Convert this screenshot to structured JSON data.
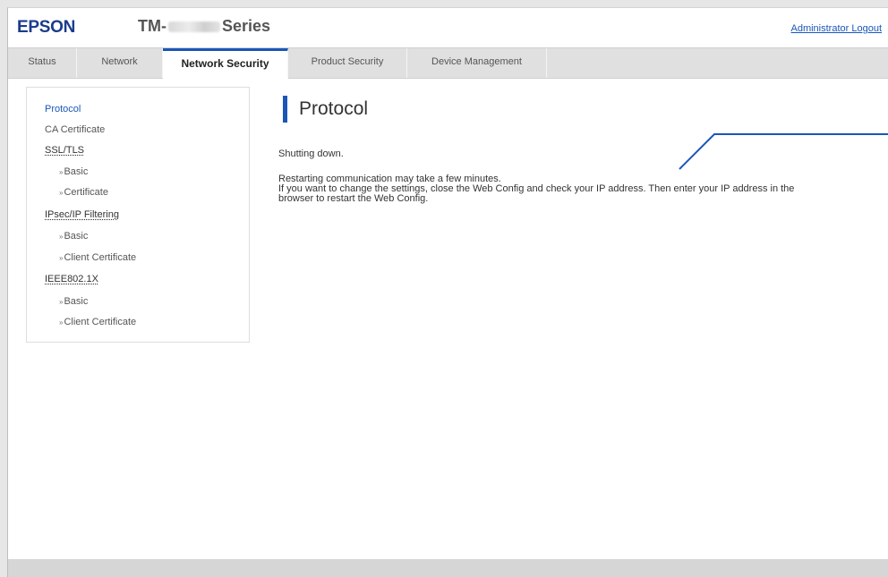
{
  "header": {
    "brand": "EPSON",
    "model_prefix": "TM-",
    "model_suffix": "Series",
    "logout": "Administrator Logout"
  },
  "tabs": [
    {
      "label": "Status"
    },
    {
      "label": "Network"
    },
    {
      "label": "Network Security",
      "active": true
    },
    {
      "label": "Product Security"
    },
    {
      "label": "Device Management"
    }
  ],
  "sidebar": {
    "items": [
      {
        "label": "Protocol",
        "active": true
      },
      {
        "label": "CA Certificate"
      },
      {
        "label": "SSL/TLS",
        "group": true
      },
      {
        "label": "Basic",
        "sub": true
      },
      {
        "label": "Certificate",
        "sub": true
      },
      {
        "label": "IPsec/IP Filtering",
        "group": true
      },
      {
        "label": "Basic",
        "sub": true
      },
      {
        "label": "Client Certificate",
        "sub": true
      },
      {
        "label": "IEEE802.1X",
        "group": true
      },
      {
        "label": "Basic",
        "sub": true
      },
      {
        "label": "Client Certificate",
        "sub": true
      }
    ],
    "bullet": "»"
  },
  "main": {
    "title": "Protocol",
    "status": "Shutting down.",
    "line1": "Restarting communication may take a few minutes.",
    "line2": "If you want to change the settings, close the Web Config and check your IP address. Then enter your IP address in the",
    "line3": "browser to restart the Web Config."
  },
  "colors": {
    "brand": "#1a3c8c",
    "accent": "#1a56b8"
  }
}
